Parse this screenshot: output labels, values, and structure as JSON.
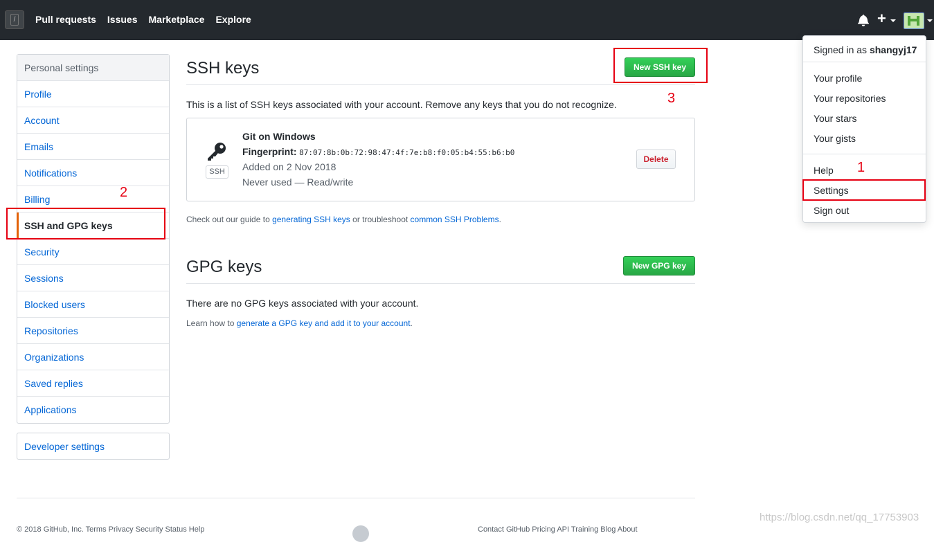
{
  "header": {
    "search_hint": "/",
    "nav": [
      "Pull requests",
      "Issues",
      "Marketplace",
      "Explore"
    ]
  },
  "sidebar": {
    "heading": "Personal settings",
    "items": [
      "Profile",
      "Account",
      "Emails",
      "Notifications",
      "Billing",
      "SSH and GPG keys",
      "Security",
      "Sessions",
      "Blocked users",
      "Repositories",
      "Organizations",
      "Saved replies",
      "Applications"
    ],
    "active": "SSH and GPG keys",
    "developer": "Developer settings"
  },
  "ssh": {
    "title": "SSH keys",
    "new_button": "New SSH key",
    "intro": "This is a list of SSH keys associated with your account. Remove any keys that you do not recognize.",
    "key": {
      "tag": "SSH",
      "name": "Git on Windows",
      "fingerprint_label": "Fingerprint:",
      "fingerprint": "87:07:8b:0b:72:98:47:4f:7e:b8:f0:05:b4:55:b6:b0",
      "added": "Added on 2 Nov 2018",
      "used": "Never used — Read/write",
      "delete": "Delete"
    },
    "help_prefix": "Check out our guide to ",
    "help_link1": "generating SSH keys",
    "help_middle": " or troubleshoot ",
    "help_link2": "common SSH Problems",
    "help_suffix": "."
  },
  "gpg": {
    "title": "GPG keys",
    "new_button": "New GPG key",
    "empty": "There are no GPG keys associated with your account.",
    "help_prefix": "Learn how to ",
    "help_link": "generate a GPG key and add it to your account",
    "help_suffix": "."
  },
  "dropdown": {
    "signed_prefix": "Signed in as ",
    "username": "shangyj17",
    "items": [
      "Your profile",
      "Your repositories",
      "Your stars",
      "Your gists",
      "Help",
      "Settings",
      "Sign out"
    ]
  },
  "footer": {
    "left": "© 2018 GitHub, Inc.   Terms   Privacy   Security   Status   Help",
    "right": "Contact GitHub   Pricing   API   Training   Blog   About"
  },
  "watermark": "https://blog.csdn.net/qq_17753903",
  "annotations": [
    "1",
    "2",
    "3"
  ],
  "colors": {
    "header_bg": "#24292e",
    "link": "#0366d6",
    "green": "#28a745",
    "annotation": "#e60012",
    "active_marker": "#e36209"
  }
}
